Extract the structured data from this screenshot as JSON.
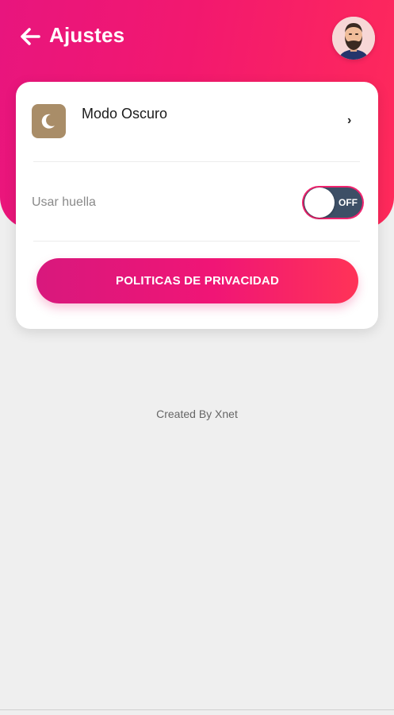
{
  "header": {
    "title": "Ajustes",
    "back_icon": "arrow-left-icon",
    "avatar_icon": "bearded-man-avatar"
  },
  "settings": {
    "dark_mode": {
      "label": "Modo Oscuro",
      "icon": "moon-icon",
      "chevron": "›"
    },
    "fingerprint": {
      "label": "Usar huella",
      "toggle_text": "OFF",
      "enabled": false
    },
    "privacy_button": {
      "label": "POLITICAS DE PRIVACIDAD"
    }
  },
  "footer": {
    "credit": "Created By Xnet"
  },
  "colors": {
    "accent": "#f0236f",
    "toggle_track": "#3d4f66",
    "tile": "#a98d68"
  }
}
